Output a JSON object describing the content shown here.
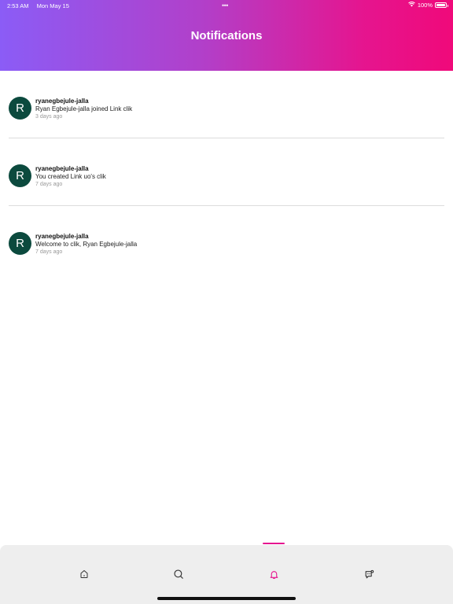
{
  "status_bar": {
    "time": "2:53 AM",
    "date": "Mon May 15",
    "battery": "100%",
    "battery_level": 1.0
  },
  "header": {
    "title": "Notifications"
  },
  "notifications": [
    {
      "avatar_letter": "R",
      "username": "ryanegbejule-jalla",
      "message": "Ryan Egbejule-jalla joined Link clik",
      "time": "3 days ago"
    },
    {
      "avatar_letter": "R",
      "username": "ryanegbejule-jalla",
      "message": "You created Link uo's clik",
      "time": "7 days ago"
    },
    {
      "avatar_letter": "R",
      "username": "ryanegbejule-jalla",
      "message": "Welcome to clik, Ryan Egbejule-jalla",
      "time": "7 days ago"
    }
  ],
  "tabbar": {
    "active": "notifications",
    "tabs": [
      {
        "id": "home",
        "icon": "home-icon"
      },
      {
        "id": "search",
        "icon": "search-icon"
      },
      {
        "id": "notifications",
        "icon": "bell-icon"
      },
      {
        "id": "messages",
        "icon": "chat-icon"
      }
    ],
    "active_color": "#e5158f",
    "inactive_color": "#333333"
  },
  "colors": {
    "gradient_start": "#8b5cf6",
    "gradient_end": "#f0097a",
    "avatar_bg": "#0c4a3e"
  }
}
